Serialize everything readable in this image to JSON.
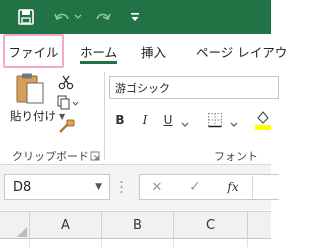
{
  "colors": {
    "title_bar": "#217346",
    "accent": "#217346",
    "file_highlight": "#f2aac6"
  },
  "quick_access": {
    "icons": [
      "save-icon",
      "undo-icon",
      "undo-dropdown-icon",
      "redo-icon",
      "customize-qat-icon"
    ]
  },
  "tabs": [
    {
      "label": "ファイル",
      "name": "tab-file"
    },
    {
      "label": "ホーム",
      "name": "tab-home",
      "selected": true
    },
    {
      "label": "挿入",
      "name": "tab-insert"
    },
    {
      "label": "ページ レイアウ",
      "name": "tab-page-layout"
    }
  ],
  "ribbon": {
    "clipboard": {
      "paste_label": "貼り付け",
      "group_label": "クリップボード",
      "icons": [
        "paste-icon",
        "cut-icon",
        "copy-icon",
        "format-painter-icon",
        "dialog-launcher-icon"
      ]
    },
    "font": {
      "font_name": "游ゴシック",
      "group_label": "フォント",
      "bold": "B",
      "italic": "I",
      "underline": "U",
      "icons": [
        "underline-dropdown-icon",
        "border-icon",
        "border-dropdown-icon",
        "fill-color-icon"
      ]
    }
  },
  "formula_bar": {
    "name_box": "D8",
    "cancel_symbol": "✕",
    "enter_symbol": "✓",
    "fx_symbol": "fx",
    "value": ""
  },
  "columns": [
    "A",
    "B",
    "C"
  ]
}
